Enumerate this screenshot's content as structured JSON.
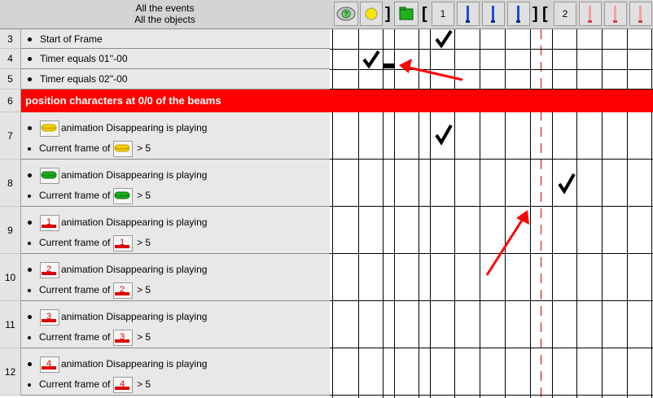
{
  "header": {
    "line1": "All the events",
    "line2": "All the objects",
    "group1_label": "1",
    "group2_label": "2",
    "bracket_left": "[",
    "bracket_right": "]"
  },
  "rows": [
    {
      "num": "3",
      "lines": [
        {
          "text": "Start of Frame"
        }
      ]
    },
    {
      "num": "4",
      "lines": [
        {
          "text": "Timer equals 01''-00"
        }
      ]
    },
    {
      "num": "5",
      "lines": [
        {
          "text": "Timer equals 02''-00"
        }
      ]
    },
    {
      "num": "6",
      "comment": "position characters at 0/0 of the beams"
    },
    {
      "num": "7",
      "lines": [
        {
          "text": "animation Disappearing is playing"
        },
        {
          "prefix": "Current frame of",
          "suffix": "> 5"
        }
      ],
      "icon_label": "PLAYER"
    },
    {
      "num": "8",
      "lines": [
        {
          "text": "animation Disappearing is playing"
        },
        {
          "prefix": "Current frame of",
          "suffix": "> 5"
        }
      ],
      "icon_label": "PLAYER"
    },
    {
      "num": "9",
      "lines": [
        {
          "text": "animation Disappearing is playing"
        },
        {
          "prefix": "Current frame of",
          "suffix": "> 5"
        }
      ],
      "icon_label": "1"
    },
    {
      "num": "10",
      "lines": [
        {
          "text": "animation Disappearing is playing"
        },
        {
          "prefix": "Current frame of",
          "suffix": "> 5"
        }
      ],
      "icon_label": "2"
    },
    {
      "num": "11",
      "lines": [
        {
          "text": "animation Disappearing is playing"
        },
        {
          "prefix": "Current frame of",
          "suffix": "> 5"
        }
      ],
      "icon_label": "3"
    },
    {
      "num": "12",
      "lines": [
        {
          "text": "animation Disappearing is playing"
        },
        {
          "prefix": "Current frame of",
          "suffix": "> 5"
        }
      ],
      "icon_label": "4"
    }
  ],
  "colors": {
    "comment_bg": "#ff0000",
    "annotation_arrow": "#ff0000",
    "icon_yellow": "#f5d400",
    "icon_green": "#1db31d",
    "icon_red": "#dd0000",
    "blue_bar": "#1a4fd8",
    "pink_bar": "#f08080"
  },
  "icons": [
    "help-icon",
    "timer-icon",
    "folder-icon",
    "blue-object-icon",
    "red-object-icon",
    "checkmark-icon"
  ]
}
